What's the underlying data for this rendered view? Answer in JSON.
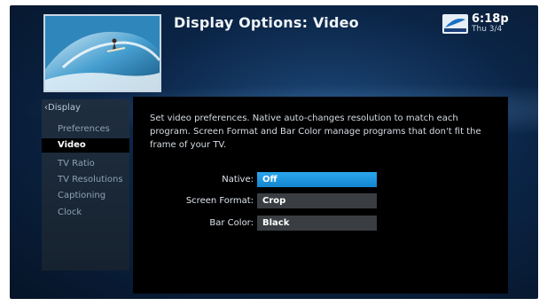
{
  "header": {
    "title": "Display Options: Video",
    "clock": "6:18p",
    "date": "Thu 3/4",
    "logo_icon": "directv-logo-icon"
  },
  "sidebar": {
    "back_label": "Display",
    "items": [
      {
        "label": "Preferences",
        "active": false
      },
      {
        "label": "Video",
        "active": true
      },
      {
        "label": "TV Ratio",
        "active": false
      },
      {
        "label": "TV Resolutions",
        "active": false
      },
      {
        "label": "Captioning",
        "active": false
      },
      {
        "label": "Clock",
        "active": false
      }
    ]
  },
  "main": {
    "description": "Set video preferences. Native auto-changes resolution to match each program. Screen Format and Bar Color manage programs that don't fit the frame of your TV.",
    "settings": [
      {
        "label": "Native:",
        "value": "Off",
        "selected": true
      },
      {
        "label": "Screen Format:",
        "value": "Crop",
        "selected": false
      },
      {
        "label": "Bar Color:",
        "value": "Black",
        "selected": false
      }
    ]
  },
  "colors": {
    "accent": "#1a96e0",
    "background": "#0b2547",
    "panel": "#000000"
  }
}
